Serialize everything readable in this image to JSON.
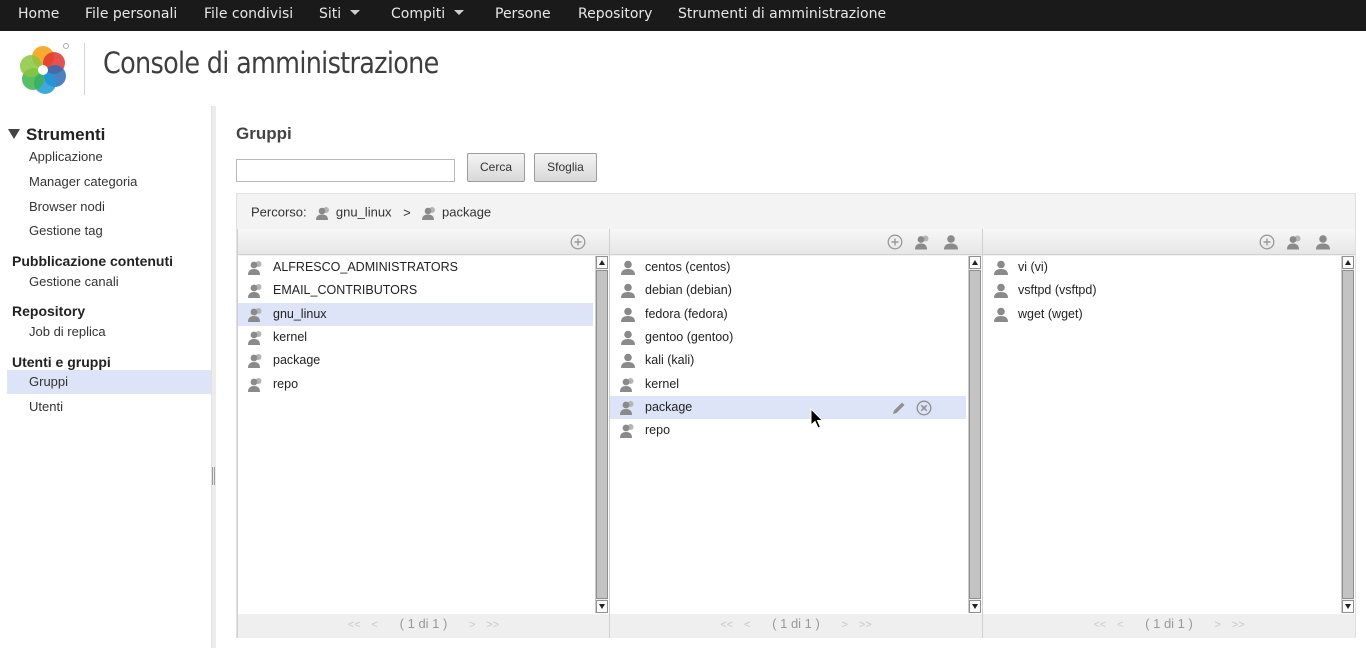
{
  "nav": {
    "items": [
      {
        "label": "Home"
      },
      {
        "label": "File personali"
      },
      {
        "label": "File condivisi"
      },
      {
        "label": "Siti"
      },
      {
        "label": "Compiti"
      },
      {
        "label": "Persone"
      },
      {
        "label": "Repository"
      },
      {
        "label": "Strumenti di amministrazione"
      }
    ]
  },
  "header": {
    "title": "Console di amministrazione"
  },
  "sidebar": {
    "tools_title": "Strumenti",
    "sections": [
      {
        "items": [
          "Applicazione",
          "Manager categoria",
          "Browser nodi",
          "Gestione tag"
        ]
      },
      {
        "title": "Pubblicazione contenuti",
        "items": [
          "Gestione canali"
        ]
      },
      {
        "title": "Repository",
        "items": [
          "Job di replica"
        ]
      },
      {
        "title": "Utenti e gruppi",
        "items": [
          "Gruppi",
          "Utenti"
        ],
        "selected": "Gruppi"
      }
    ]
  },
  "main": {
    "title": "Gruppi",
    "search": {
      "value": "",
      "placeholder": ""
    },
    "search_button": "Cerca",
    "browse_button": "Sfoglia",
    "breadcrumb": {
      "label": "Percorso:",
      "path": [
        "gnu_linux",
        "package"
      ],
      "separator": ">"
    },
    "columns": [
      {
        "items": [
          {
            "label": "ALFRESCO_ADMINISTRATORS",
            "type": "group"
          },
          {
            "label": "EMAIL_CONTRIBUTORS",
            "type": "group"
          },
          {
            "label": "gnu_linux",
            "type": "group",
            "selected": true
          },
          {
            "label": "kernel",
            "type": "group"
          },
          {
            "label": "package",
            "type": "group"
          },
          {
            "label": "repo",
            "type": "group"
          }
        ],
        "pager": "( 1 di 1 )"
      },
      {
        "items": [
          {
            "label": "centos (centos)",
            "type": "user"
          },
          {
            "label": "debian (debian)",
            "type": "user"
          },
          {
            "label": "fedora (fedora)",
            "type": "user"
          },
          {
            "label": "gentoo (gentoo)",
            "type": "user"
          },
          {
            "label": "kali (kali)",
            "type": "user"
          },
          {
            "label": "kernel",
            "type": "group"
          },
          {
            "label": "package",
            "type": "group",
            "selected": true
          },
          {
            "label": "repo",
            "type": "group"
          }
        ],
        "pager": "( 1 di 1 )"
      },
      {
        "items": [
          {
            "label": "vi (vi)",
            "type": "user"
          },
          {
            "label": "vsftpd (vsftpd)",
            "type": "user"
          },
          {
            "label": "wget (wget)",
            "type": "user"
          }
        ],
        "pager": "( 1 di 1 )"
      }
    ],
    "pager_nav": {
      "first": "<<",
      "prev": "<",
      "next": ">",
      "last": ">>"
    }
  },
  "colors": {
    "topbar": "#1a1a1a",
    "selection": "#dde4f8",
    "icon": "#8a8a8a"
  }
}
